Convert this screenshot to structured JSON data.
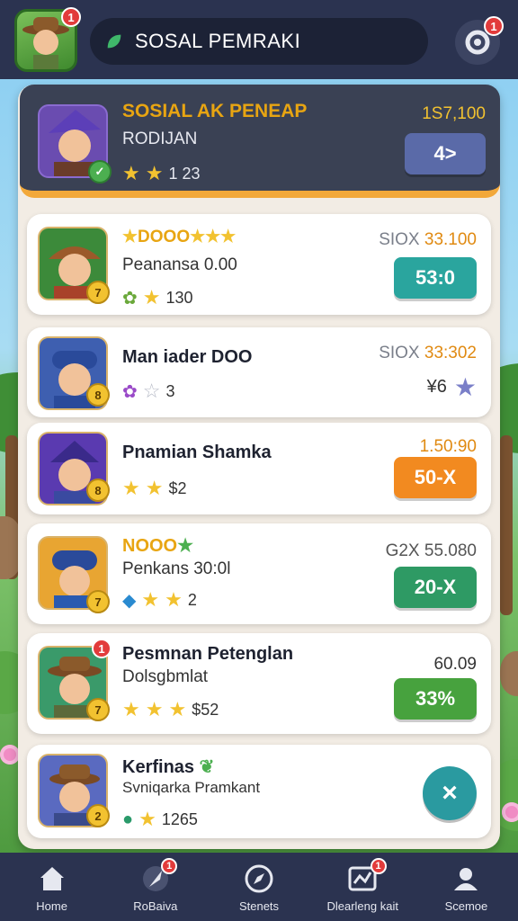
{
  "topbar": {
    "title": "SOSAL PEMRAKI",
    "avatar_badge": "1",
    "settings_badge": "1"
  },
  "header": {
    "title": "SOSIAL AK PENEAP",
    "subtitle": "RODIJAN",
    "stars": "1 23",
    "value": "1S7,100",
    "button": "4>"
  },
  "entries": [
    {
      "name": "DOOO",
      "sub": "Peanansa 0.00",
      "stat": "130",
      "badge": "7",
      "right_label": "SIOX",
      "right_value": "33.100",
      "button": "53:0"
    },
    {
      "name": "Man iader DOO",
      "sub": "",
      "stat": "3",
      "badge": "8",
      "right_label": "SIOX",
      "right_value": "33:302",
      "button": "¥6"
    },
    {
      "name": "Pnamian Shamka",
      "sub": "",
      "stat": "$2",
      "badge": "8",
      "right_label": "",
      "right_value": "1.50:90",
      "button": "50-X"
    },
    {
      "name": "NOOO",
      "sub": "Penkans 30:0l",
      "stat": "2",
      "badge": "7",
      "right_label": "G2X",
      "right_value": "55.080",
      "button": "20-X"
    },
    {
      "name": "Pesmnan Petenglan",
      "sub": "Dolsgbmlat",
      "stat": "$52",
      "badge": "7",
      "portrait_notif": "1",
      "right_label": "",
      "right_value": "60.09",
      "button": "33%"
    },
    {
      "name": "Kerfinas",
      "sub": "Svniqarka Pramkant",
      "stat": "1265",
      "badge": "2",
      "right_label": "",
      "right_value": "",
      "button": "×"
    }
  ],
  "nav": [
    {
      "label": "Home",
      "icon": "home-icon"
    },
    {
      "label": "RoBaiva",
      "icon": "feather-icon",
      "badge": "1"
    },
    {
      "label": "Stenets",
      "icon": "compass-icon"
    },
    {
      "label": "Dlearleng kait",
      "icon": "map-icon",
      "badge": "1"
    },
    {
      "label": "Scemoe",
      "icon": "profile-icon"
    }
  ],
  "colors": {
    "header_bg": "#3a4154",
    "accent_orange": "#f2a83a",
    "teal": "#2aa59e",
    "orange": "#f28a20",
    "green": "#2e9a64"
  }
}
